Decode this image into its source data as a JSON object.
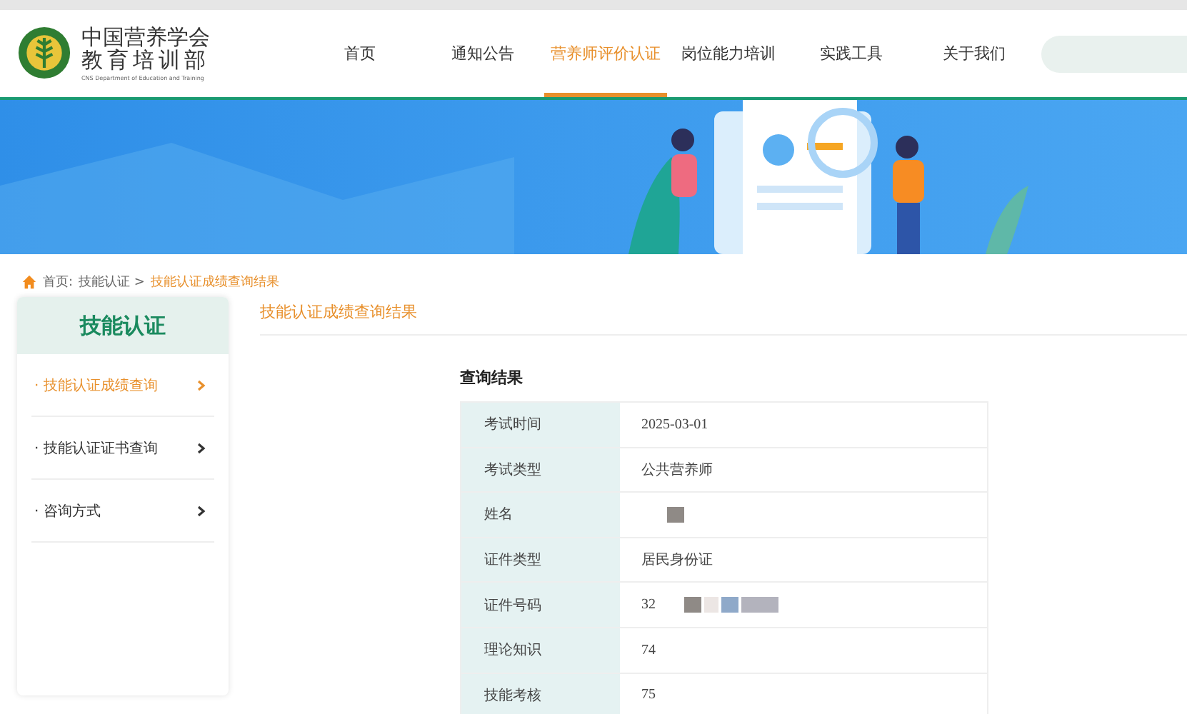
{
  "logo": {
    "title_line1": "中国营养学会",
    "title_line2": "教育培训部",
    "subtitle": "CNS Department of Education and Training"
  },
  "nav": [
    {
      "label": "首页",
      "selected": false
    },
    {
      "label": "通知公告",
      "selected": false
    },
    {
      "label": "营养师评价认证",
      "selected": true
    },
    {
      "label": "岗位能力培训",
      "selected": false
    },
    {
      "label": "实践工具",
      "selected": false
    },
    {
      "label": "关于我们",
      "selected": false
    }
  ],
  "breadcrumb": [
    {
      "label": "首页:",
      "current": false
    },
    {
      "label": "技能认证 >",
      "current": false
    },
    {
      "label": "技能认证成绩查询结果",
      "current": true
    }
  ],
  "sidebar": {
    "title": "技能认证",
    "items": [
      {
        "label": "· 技能认证成绩查询",
        "selected": true
      },
      {
        "label": "· 技能认证证书查询",
        "selected": false
      },
      {
        "label": "· 咨询方式",
        "selected": false
      }
    ]
  },
  "content": {
    "title": "技能认证成绩查询结果",
    "result_title": "查询结果",
    "rows": [
      {
        "label": "考试时间",
        "value": "2025-03-01",
        "redacted": false
      },
      {
        "label": "考试类型",
        "value": "公共营养师",
        "redacted": false
      },
      {
        "label": "姓名",
        "redacted": true
      },
      {
        "label": "证件类型",
        "value": "居民身份证",
        "redacted": false
      },
      {
        "label": "证件号码",
        "value": "32",
        "redacted": true
      },
      {
        "label": "理论知识",
        "value": "74",
        "redacted": false
      },
      {
        "label": "技能考核",
        "value": "75",
        "redacted": false
      }
    ]
  }
}
